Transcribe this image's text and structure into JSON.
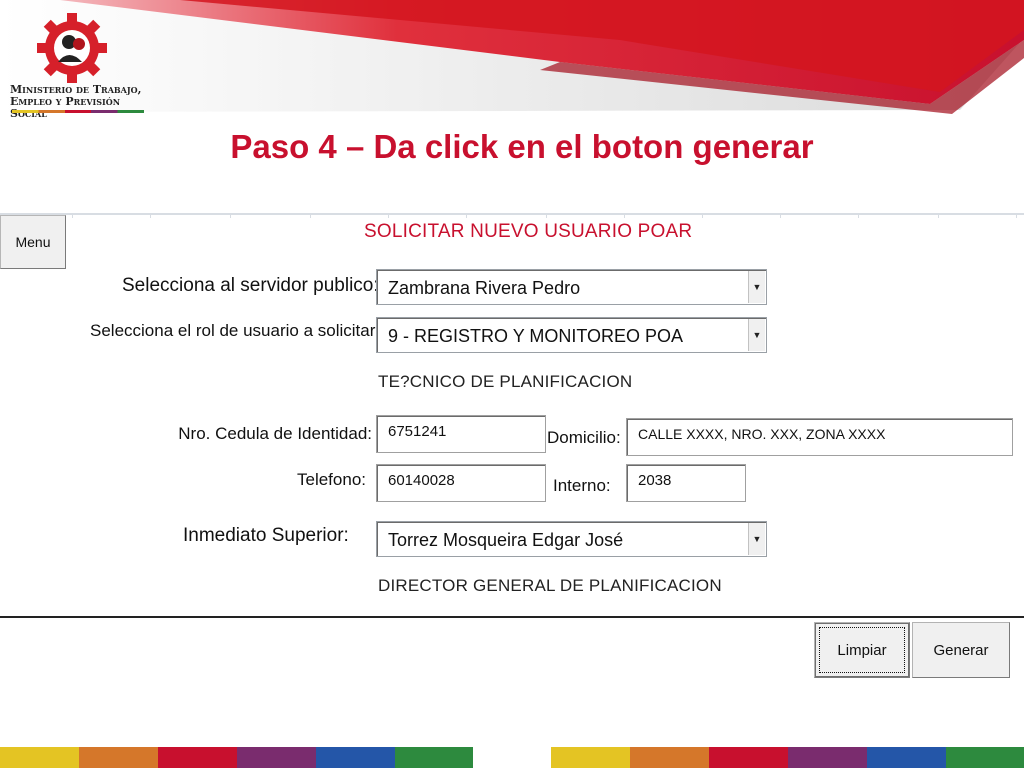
{
  "header": {
    "logo_line1": "Ministerio de Trabajo,",
    "logo_line2": "Empleo y Previsión Social"
  },
  "slide": {
    "title": "Paso 4 – Da click en el boton generar"
  },
  "form": {
    "menu_label": "Menu",
    "title": "SOLICITAR NUEVO USUARIO POAR",
    "servidor_label": "Selecciona al servidor publico:",
    "servidor_value": "Zambrana Rivera Pedro",
    "rol_label": "Selecciona el rol de usuario a solicitar:",
    "rol_value": "9 - REGISTRO Y MONITOREO POA",
    "cargo_text": "TE?CNICO DE PLANIFICACION",
    "cedula_label": "Nro. Cedula de Identidad:",
    "cedula_value": "6751241",
    "domicilio_label": "Domicilio:",
    "domicilio_value": "CALLE XXXX, NRO. XXX, ZONA XXXX",
    "telefono_label": "Telefono:",
    "telefono_value": "60140028",
    "interno_label": "Interno:",
    "interno_value": "2038",
    "superior_label": "Inmediato Superior:",
    "superior_value": "Torrez Mosqueira Edgar José",
    "superior_cargo": "DIRECTOR GENERAL DE PLANIFICACION",
    "limpiar_label": "Limpiar",
    "generar_label": "Generar"
  },
  "colors": {
    "accent_red": "#c8102e",
    "footer": [
      "#e4c423",
      "#d5772a",
      "#c8102e",
      "#7a2c6e",
      "#2456a8",
      "#2d8a3e"
    ]
  }
}
